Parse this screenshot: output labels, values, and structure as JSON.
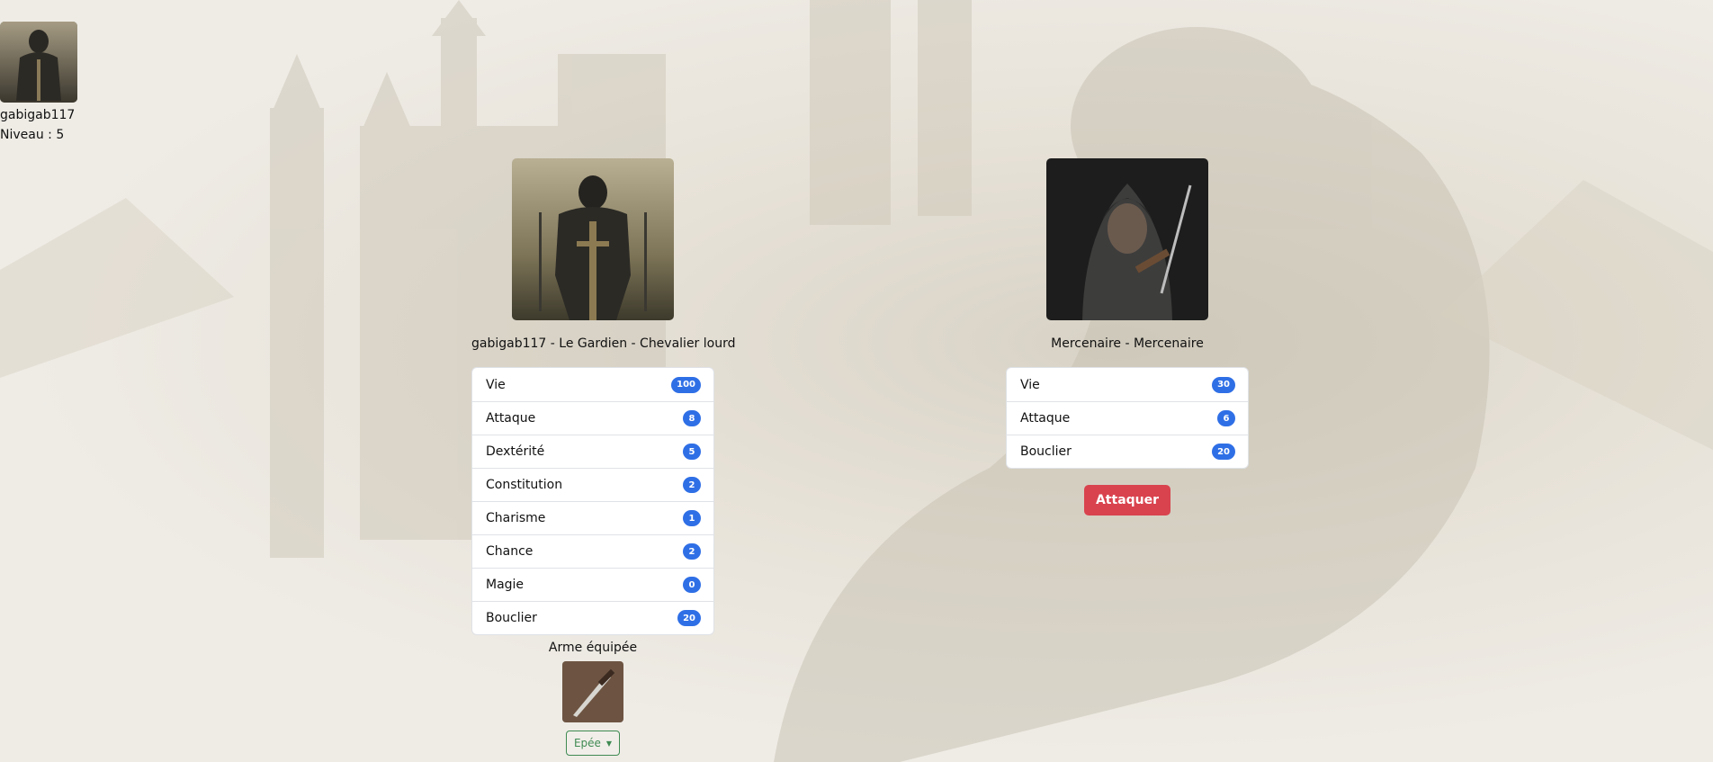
{
  "user": {
    "name": "gabigab117",
    "level": "Niveau : 5"
  },
  "player": {
    "title": "gabigab117 - Le Gardien - Chevalier lourd",
    "stats": [
      {
        "label": "Vie",
        "value": "100"
      },
      {
        "label": "Attaque",
        "value": "8"
      },
      {
        "label": "Dextérité",
        "value": "5"
      },
      {
        "label": "Constitution",
        "value": "2"
      },
      {
        "label": "Charisme",
        "value": "1"
      },
      {
        "label": "Chance",
        "value": "2"
      },
      {
        "label": "Magie",
        "value": "0"
      },
      {
        "label": "Bouclier",
        "value": "20"
      }
    ],
    "weapon_title": "Arme équipée",
    "weapon_selected": "Epée"
  },
  "enemy": {
    "title": "Mercenaire - Mercenaire",
    "stats": [
      {
        "label": "Vie",
        "value": "30"
      },
      {
        "label": "Attaque",
        "value": "6"
      },
      {
        "label": "Bouclier",
        "value": "20"
      }
    ],
    "attack_label": "Attaquer"
  },
  "colors": {
    "badge": "#2f6fe6",
    "attack_button": "#d9434e",
    "weapon_outline": "#3f8a52"
  },
  "icons": {
    "dropdown": "caret-down-icon"
  }
}
